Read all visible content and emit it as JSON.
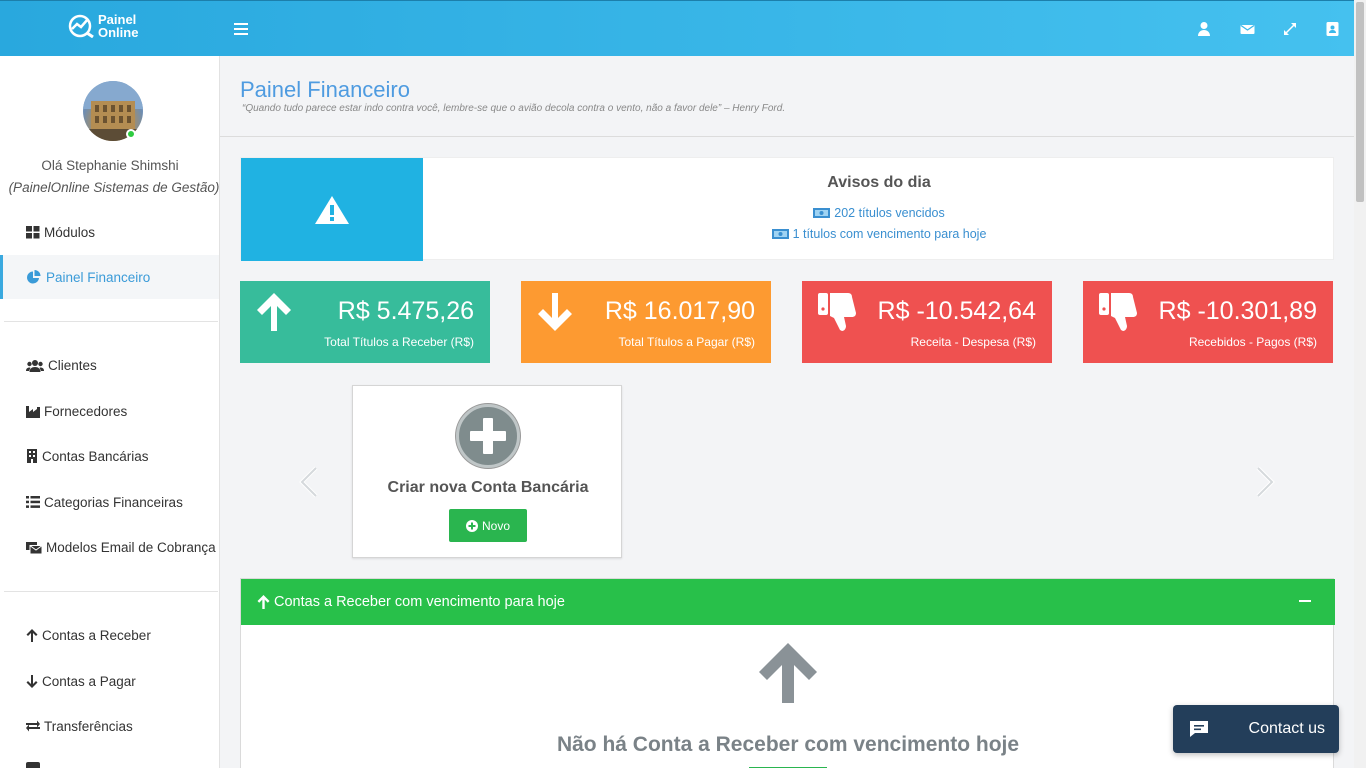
{
  "app": {
    "logo_line1": "Painel",
    "logo_line2": "Online"
  },
  "topbar": {
    "icons": [
      "user-icon",
      "envelope-icon",
      "expand-icon",
      "address-book-icon"
    ]
  },
  "sidebar": {
    "greeting": "Olá Stephanie Shimshi",
    "company": "(PainelOnline Sistemas de Gestão)",
    "items": [
      {
        "label": "Módulos",
        "icon": "grid-icon"
      },
      {
        "label": "Painel Financeiro",
        "icon": "pie-chart-icon",
        "active": true
      },
      {
        "label": "Clientes",
        "icon": "users-icon"
      },
      {
        "label": "Fornecedores",
        "icon": "industry-icon"
      },
      {
        "label": "Contas Bancárias",
        "icon": "building-icon"
      },
      {
        "label": "Categorias Financeiras",
        "icon": "list-icon"
      },
      {
        "label": "Modelos Email de Cobrança",
        "icon": "envelopes-icon"
      },
      {
        "label": "Contas a Receber",
        "icon": "arrow-up-icon"
      },
      {
        "label": "Contas a Pagar",
        "icon": "arrow-down-icon"
      },
      {
        "label": "Transferências",
        "icon": "exchange-icon"
      }
    ]
  },
  "page": {
    "title": "Painel Financeiro",
    "quote": "“Quando tudo parece estar indo contra você, lembre-se que o avião decola contra o vento, não a favor dele” – Henry Ford."
  },
  "alert": {
    "title": "Avisos do dia",
    "line1": "202 títulos vencidos",
    "line2": "1 títulos com vencimento para hoje"
  },
  "stats": [
    {
      "value": "R$ 5.475,26",
      "label": "Total Títulos a Receber (R$)",
      "color": "#37bc9b",
      "icon": "arrow-up-icon"
    },
    {
      "value": "R$ 16.017,90",
      "label": "Total Títulos a Pagar (R$)",
      "color": "#fd9a31",
      "icon": "arrow-down-icon"
    },
    {
      "value": "R$ -10.542,64",
      "label": "Receita - Despesa (R$)",
      "color": "#ef5150",
      "icon": "thumbs-down-icon"
    },
    {
      "value": "R$ -10.301,89",
      "label": "Recebidos - Pagos (R$)",
      "color": "#ef5150",
      "icon": "thumbs-down-icon"
    }
  ],
  "bank_card": {
    "title": "Criar nova Conta Bancária",
    "button": "Novo"
  },
  "panel": {
    "title": "Contas a Receber com vencimento para hoje",
    "empty_text": "Não há Conta a Receber com vencimento hoje"
  },
  "chat": {
    "label": "Contact us"
  }
}
